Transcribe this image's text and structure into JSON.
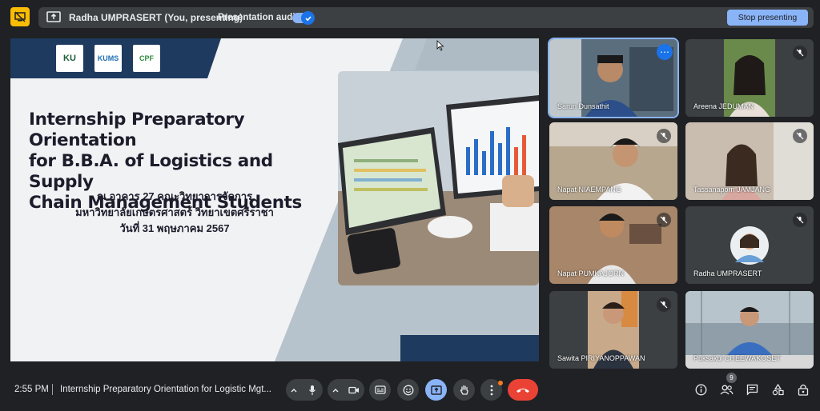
{
  "topbar": {
    "presenter_label": "Radha UMPRASERT (You, presenting)",
    "audio_label": "Presentation audio",
    "audio_enabled": true,
    "stop_label": "Stop presenting"
  },
  "slide": {
    "logos": [
      "KU",
      "KUMS",
      "CPF"
    ],
    "title_lines": [
      "Internship Preparatory Orientation",
      "for B.B.A. of Logistics and Supply",
      "Chain Management Students"
    ],
    "thai_lines": [
      "ณ อาคาร 27 คณะวิทยาการจัดการ",
      "มหาวิทยาลัยเกษตรศาสตร์ วิทยาเขตศรีราชา",
      "วันที่ 31 พฤษภาคม 2567"
    ]
  },
  "participants": [
    {
      "name": "Sarun Dunsathit",
      "muted": false,
      "active": true,
      "bg": "#5a6e7e"
    },
    {
      "name": "Areena JEDUMAN",
      "muted": true,
      "active": false,
      "bg": "#6a8a4c"
    },
    {
      "name": "Napat NIAEMPANG",
      "muted": true,
      "active": false,
      "bg": "#b7a78f"
    },
    {
      "name": "Tassanaporn JAMJANG",
      "muted": true,
      "active": false,
      "bg": "#c9bdb0"
    },
    {
      "name": "Napat PUMKAJORN",
      "muted": true,
      "active": false,
      "bg": "#a8866a"
    },
    {
      "name": "Radha UMPRASERT",
      "muted": true,
      "active": false,
      "bg": "#3c4043"
    },
    {
      "name": "Sawita PIRIYANOPPAWAN",
      "muted": true,
      "active": false,
      "bg": "#c8a98a"
    },
    {
      "name": "Puksakul CHEEWAKOSET",
      "muted": false,
      "active": false,
      "bg": "#8f9ea8"
    }
  ],
  "bottombar": {
    "time": "2:55 PM",
    "meeting_title": "Internship Preparatory Orientation for Logistic Mgt...",
    "participant_count": "9"
  },
  "icons": {
    "meet-present-icon": "screen-off",
    "mute": "mic-off-icon"
  }
}
